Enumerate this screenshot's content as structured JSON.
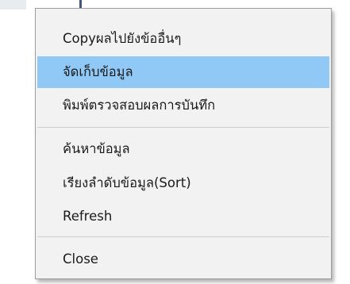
{
  "menu": {
    "items": [
      {
        "label": "Copyผลไปยังข้ออื่นๆ"
      },
      {
        "label": "จัดเก็บข้อมูล"
      },
      {
        "label": "พิมพ์ตรวจสอบผลการบันทึก"
      },
      {
        "label": "ค้นหาข้อมูล"
      },
      {
        "label": "เรียงลำดับข้อมูล(Sort)"
      },
      {
        "label": "Refresh"
      },
      {
        "label": "Close"
      }
    ],
    "highlighted_item": "จัดเก็บข้อมูล",
    "colors": {
      "background": "#f2f2f2",
      "border": "#9d9d9d",
      "highlight": "#90c8f6",
      "separator": "#cfcfcf",
      "text": "#1a1a1a"
    }
  }
}
